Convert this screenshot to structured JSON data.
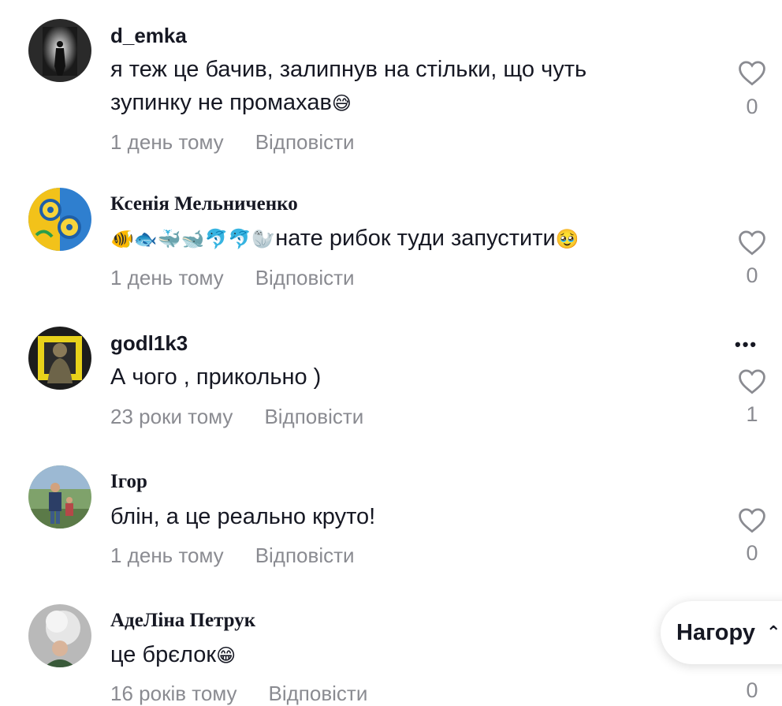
{
  "comments": [
    {
      "username": "d_emka",
      "text_line1": "я теж це бачив, залипнув на стільки, що чуть",
      "text_line2": "зупинку не промахав",
      "emoji": "😅",
      "time": "1 день тому",
      "reply_label": "Відповісти",
      "likes": "0"
    },
    {
      "username": "Ксенія Мельниченко",
      "emoji_prefix": "🐠🐟🐳🐋🐬🐬🦭",
      "text": "нате рибок туди запустити",
      "emoji": "🥹",
      "time": "1 день тому",
      "reply_label": "Відповісти",
      "likes": "0"
    },
    {
      "username": "godl1k3",
      "text": "А чого , прикольно )",
      "time": "23 роки тому",
      "reply_label": "Відповісти",
      "likes": "1",
      "more_label": "•••"
    },
    {
      "username": "Ігор",
      "text": "блін, а це реально круто!",
      "time": "1 день тому",
      "reply_label": "Відповісти",
      "likes": "0"
    },
    {
      "username": "АдеЛіна Петрук",
      "text": "це брєлок",
      "emoji": "😁",
      "time": "16 років тому",
      "reply_label": "Відповісти",
      "likes": "0"
    }
  ],
  "back_to_top": {
    "label": "Нагору",
    "icon": "chevron-up-icon"
  },
  "colors": {
    "text": "#161823",
    "secondary": "#8a8b91"
  }
}
